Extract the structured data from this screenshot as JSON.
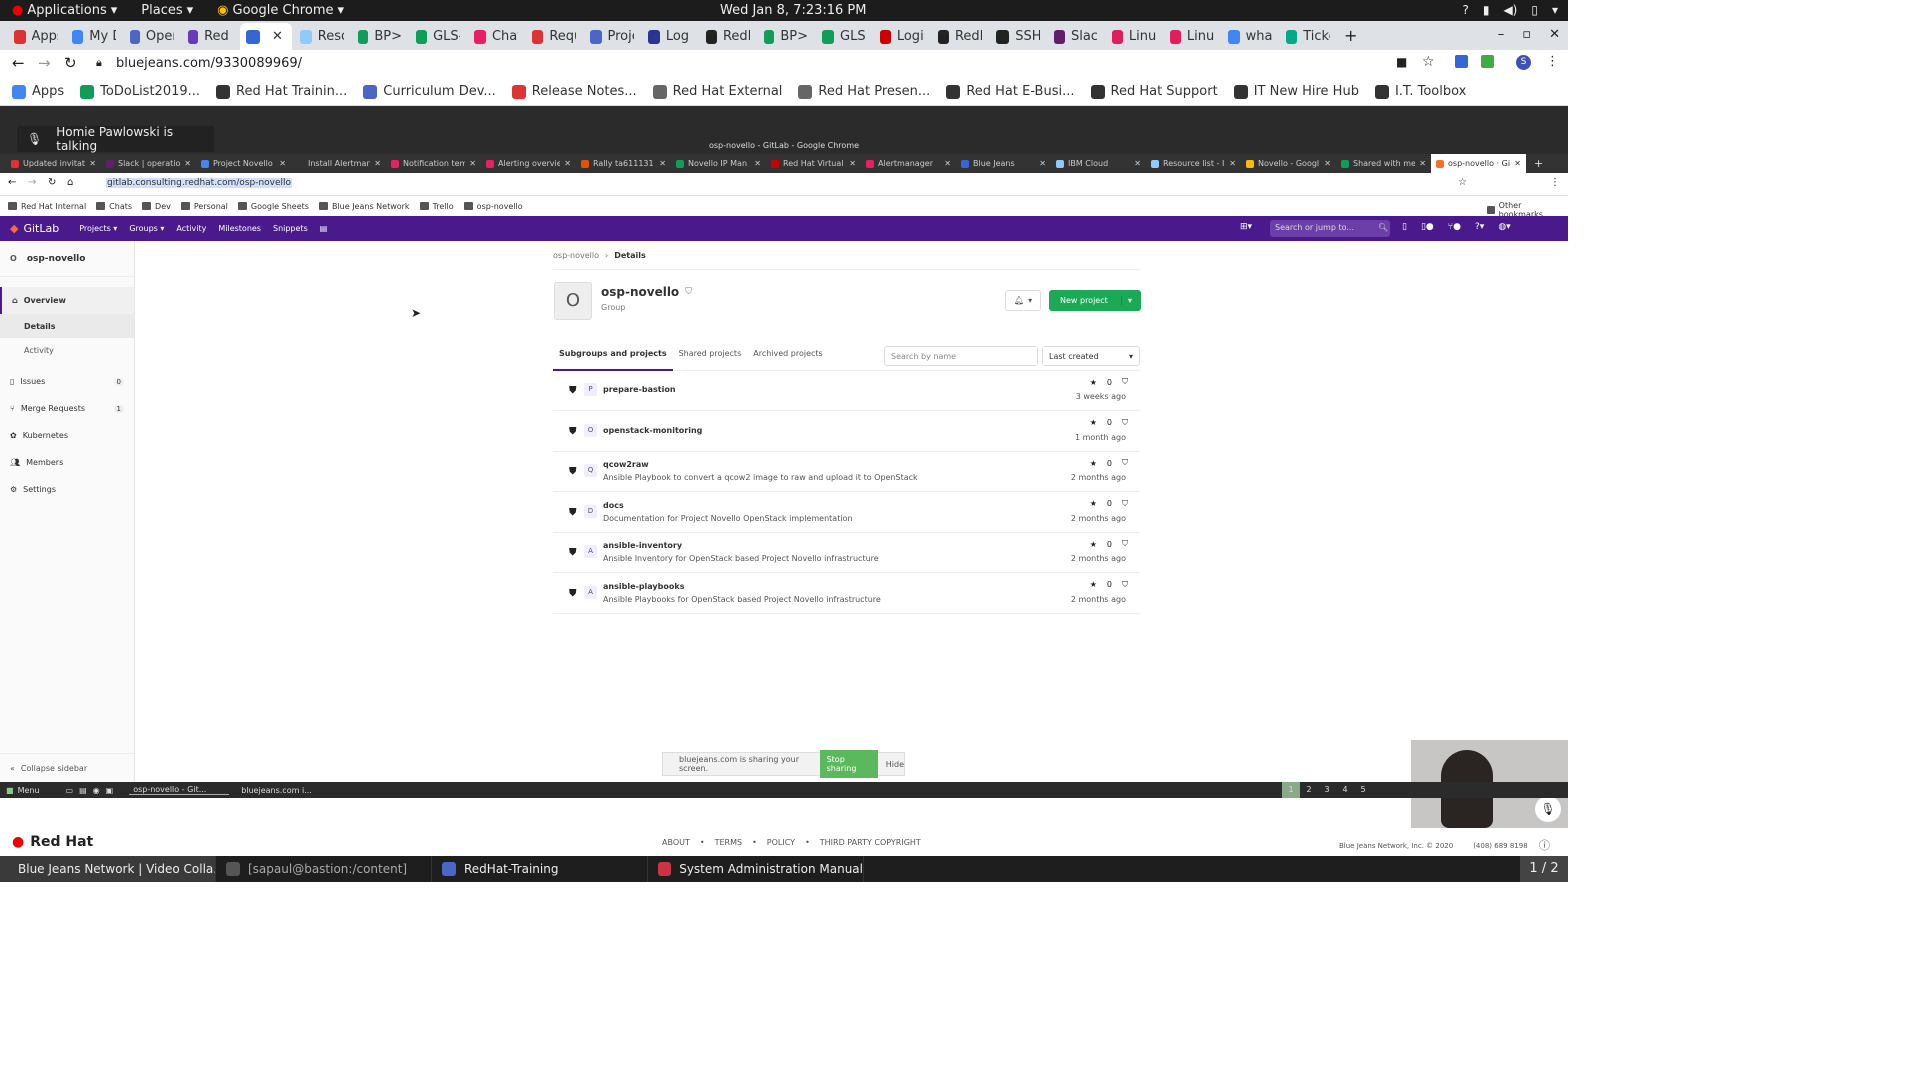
{
  "gnome": {
    "applications": "Applications",
    "places": "Places",
    "browser": "Google Chrome",
    "clock": "Wed Jan  8,  7:23:16 PM"
  },
  "outer": {
    "tabs": [
      "Apps",
      "My D",
      "Opera",
      "Red H",
      "",
      "Reso",
      "BP>H",
      "GLS-I",
      "Chat",
      "Requ",
      "Proje",
      "Log i",
      "RedH",
      "BP>H",
      "GLS-",
      "Login",
      "RedH",
      "SSH",
      "Slack",
      "Linux",
      "Linux",
      "what",
      "Ticke"
    ],
    "url": "bluejeans.com/9330089969/",
    "bookmarks": [
      "Apps",
      "ToDoList2019...",
      "Red Hat Trainin...",
      "Curriculum Dev...",
      "Release Notes...",
      "Red Hat External",
      "Red Hat Presen...",
      "Red Hat E-Busi...",
      "Red Hat Support",
      "IT New Hire Hub",
      "I.T. Toolbox"
    ]
  },
  "talking": "Homie Pawlowski is talking",
  "inner": {
    "window_title": "osp-novello - GitLab - Google Chrome",
    "tabs": [
      "Updated invitati",
      "Slack | operatio",
      "Project Novello",
      "Install Alertman",
      "Notification tem",
      "Alerting overvie",
      "Rally ta611131 (",
      "Novello IP Man",
      "Red Hat Virtual",
      "Alertmanager",
      "Blue Jeans",
      "IBM Cloud",
      "Resource list - I",
      "Novello - Googl",
      "Shared with me",
      "osp-novello · Gi"
    ],
    "url": "gitlab.consulting.redhat.com/osp-novello",
    "bookmarks": [
      "Red Hat Internal",
      "Chats",
      "Dev",
      "Personal",
      "Google Sheets",
      "Blue Jeans Network",
      "Trello",
      "osp-novello"
    ],
    "other_bookmarks": "Other bookmarks"
  },
  "gitlab": {
    "brand": "GitLab",
    "nav": [
      "Projects",
      "Groups",
      "Activity",
      "Milestones",
      "Snippets"
    ],
    "search_placeholder": "Search or jump to...",
    "group_letter": "O",
    "group_name": "osp-novello",
    "sidebar": [
      {
        "label": "Overview",
        "count": ""
      },
      {
        "label": "Details",
        "count": ""
      },
      {
        "label": "Activity",
        "count": ""
      },
      {
        "label": "Issues",
        "count": "0"
      },
      {
        "label": "Merge Requests",
        "count": "1"
      },
      {
        "label": "Kubernetes",
        "count": ""
      },
      {
        "label": "Members",
        "count": ""
      },
      {
        "label": "Settings",
        "count": ""
      }
    ],
    "collapse": "Collapse sidebar",
    "breadcrumb": [
      "osp-novello",
      "Details"
    ],
    "group_title": "osp-novello",
    "group_type": "Group",
    "new_project": "New project",
    "tabs": [
      "Subgroups and projects",
      "Shared projects",
      "Archived projects"
    ],
    "search_by_name": "Search by name",
    "sort": "Last created",
    "projects": [
      {
        "letter": "P",
        "name": "prepare-bastion",
        "desc": "",
        "stars": "0",
        "time": "3 weeks ago"
      },
      {
        "letter": "O",
        "name": "openstack-monitoring",
        "desc": "",
        "stars": "0",
        "time": "1 month ago"
      },
      {
        "letter": "Q",
        "name": "qcow2raw",
        "desc": "Ansible Playbook to convert a qcow2 image to raw and upload it to OpenStack",
        "stars": "0",
        "time": "2 months ago"
      },
      {
        "letter": "D",
        "name": "docs",
        "desc": "Documentation for Project Novello OpenStack implementation",
        "stars": "0",
        "time": "2 months ago"
      },
      {
        "letter": "A",
        "name": "ansible-inventory",
        "desc": "Ansible Inventory for OpenStack based Project Novello infrastructure",
        "stars": "0",
        "time": "2 months ago"
      },
      {
        "letter": "A",
        "name": "ansible-playbooks",
        "desc": "Ansible Playbooks for OpenStack based Project Novello infrastructure",
        "stars": "0",
        "time": "2 months ago"
      }
    ]
  },
  "sharing": {
    "text": "bluejeans.com is sharing your screen.",
    "stop": "Stop sharing",
    "hide": "Hide"
  },
  "inner_taskbar": {
    "menu": "Menu",
    "items": [
      "osp-novello - Git...",
      "bluejeans.com i..."
    ],
    "workspaces": [
      "1",
      "2",
      "3",
      "4",
      "5"
    ]
  },
  "bluejeans_footer": {
    "brand": "Red Hat",
    "links": [
      "ABOUT",
      "TERMS",
      "POLICY",
      "THIRD PARTY COPYRIGHT"
    ],
    "copyright": "Blue Jeans Network, Inc. © 2020",
    "phone": "(408) 689 8198"
  },
  "os_taskbar": {
    "items": [
      "Blue Jeans Network | Video Colla...",
      "[sapaul@bastion:/content]",
      "RedHat-Training",
      "System Administration Manual"
    ],
    "pager": "1 / 2"
  }
}
